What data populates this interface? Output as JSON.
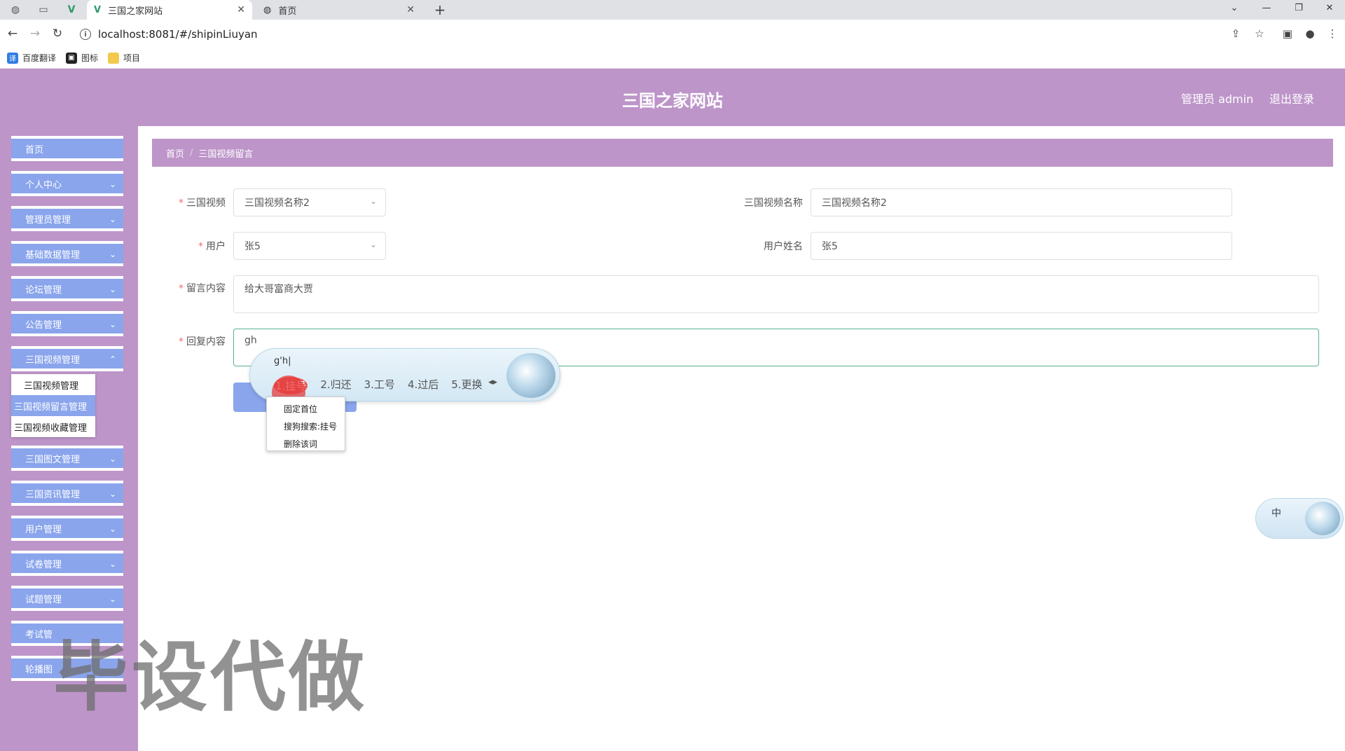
{
  "browser": {
    "tabs": [
      {
        "title": "三国之家网站",
        "active": true
      },
      {
        "title": "首页",
        "active": false
      }
    ],
    "url": "localhost:8081/#/shipinLiuyan",
    "bookmarks": [
      "百度翻译",
      "图标",
      "项目"
    ]
  },
  "header": {
    "site_title": "三国之家网站",
    "admin_label": "管理员 admin",
    "logout_label": "退出登录"
  },
  "sidebar": {
    "items": [
      {
        "label": "首页"
      },
      {
        "label": "个人中心"
      },
      {
        "label": "管理员管理"
      },
      {
        "label": "基础数据管理"
      },
      {
        "label": "论坛管理"
      },
      {
        "label": "公告管理"
      },
      {
        "label": "三国视频管理"
      },
      {
        "label": "三国图文管理"
      },
      {
        "label": "三国资讯管理"
      },
      {
        "label": "用户管理"
      },
      {
        "label": "试卷管理"
      },
      {
        "label": "试题管理"
      },
      {
        "label": "考试管"
      },
      {
        "label": "轮播图"
      }
    ],
    "submenu": [
      {
        "label": "三国视频管理"
      },
      {
        "label": "三国视频留言管理",
        "active": true
      },
      {
        "label": "三国视频收藏管理"
      }
    ]
  },
  "breadcrumb": {
    "home": "首页",
    "current": "三国视频留言"
  },
  "form": {
    "video_label": "三国视频",
    "video_value": "三国视频名称2",
    "video_name_label": "三国视频名称",
    "video_name_value": "三国视频名称2",
    "user_label": "用户",
    "user_value": "张5",
    "user_name_label": "用户姓名",
    "user_name_value": "张5",
    "message_label": "留言内容",
    "message_value": "给大哥富商大贾",
    "reply_label": "回复内容",
    "reply_value": "gh"
  },
  "ime": {
    "composition": "g'h|",
    "candidates": [
      "1.挂号",
      "2.归还",
      "3.工号",
      "4.过后",
      "5.更换"
    ],
    "context_menu": [
      "固定首位",
      "搜狗搜索:挂号",
      "删除该词"
    ],
    "status_char": "中"
  },
  "watermark": "毕设代做"
}
